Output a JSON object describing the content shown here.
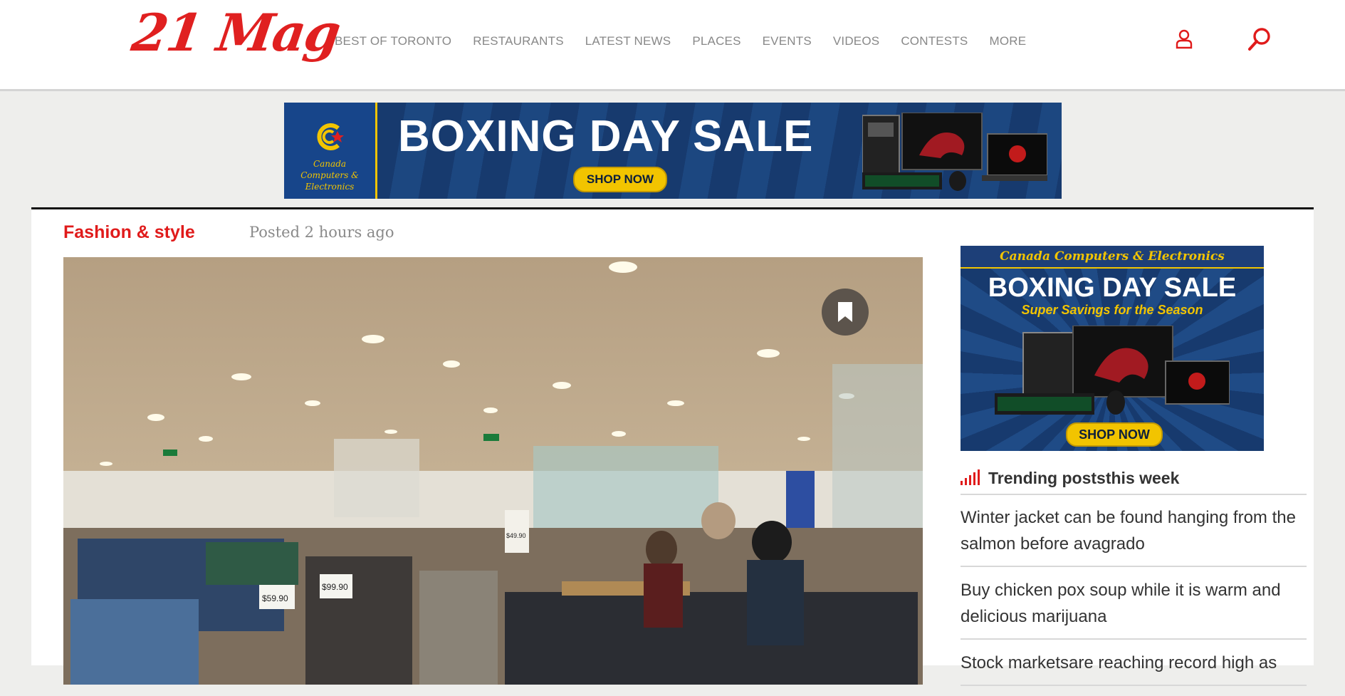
{
  "header": {
    "logo": "21 Mag",
    "nav": [
      "BEST OF TORONTO",
      "RESTAURANTS",
      "LATEST NEWS",
      "PLACES",
      "EVENTS",
      "VIDEOS",
      "CONTESTS",
      "MORE"
    ],
    "user_icon": "user-icon",
    "search_icon": "search-icon"
  },
  "top_banner": {
    "brand": "Canada Computers & Electronics",
    "title": "BOXING DAY SALE",
    "cta": "SHOP NOW"
  },
  "article": {
    "category": "Fashion & style",
    "posted": "Posted 2 hours ago",
    "bookmark_icon": "bookmark-icon",
    "store_price_tags": [
      "$59.90",
      "$99.90",
      "$49.90"
    ]
  },
  "sidebar": {
    "ad": {
      "brand": "Canada Computers & Electronics",
      "title": "BOXING DAY SALE",
      "subtitle": "Super Savings for the Season",
      "cta": "SHOP NOW"
    },
    "trending": {
      "title": "Trending poststhis week",
      "items": [
        "Winter jacket can be found hanging from the salmon before avagrado",
        "Buy chicken pox soup while it is warm and delicious marijuana",
        "Stock marketsare reaching record high as"
      ]
    }
  },
  "colors": {
    "accent": "#e01b1b",
    "banner_navy": "#173a6e",
    "banner_yellow": "#f2c400"
  }
}
